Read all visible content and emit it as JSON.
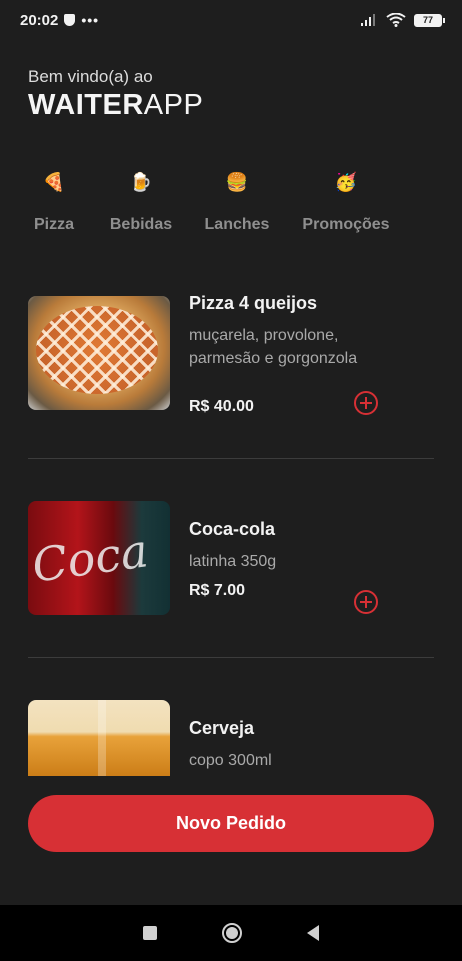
{
  "status": {
    "time": "20:02",
    "more": "•••",
    "battery": "77"
  },
  "header": {
    "greeting": "Bem vindo(a) ao",
    "brand_bold": "WAITER",
    "brand_light": "APP"
  },
  "categories": [
    {
      "icon": "🍕",
      "label": "Pizza"
    },
    {
      "icon": "🍺",
      "label": "Bebidas"
    },
    {
      "icon": "🍔",
      "label": "Lanches"
    },
    {
      "icon": "🥳",
      "label": "Promoções"
    }
  ],
  "products": [
    {
      "name": "Pizza 4 queijos",
      "description": "muçarela, provolone, parmesão e gorgonzola",
      "price": "R$ 40.00"
    },
    {
      "name": "Coca-cola",
      "description": "latinha 350g",
      "price": "R$ 7.00"
    },
    {
      "name": "Cerveja",
      "description": "copo 300ml",
      "price": ""
    }
  ],
  "actions": {
    "new_order_label": "Novo Pedido"
  },
  "colors": {
    "accent": "#d73035",
    "background": "#1e1e1e"
  }
}
